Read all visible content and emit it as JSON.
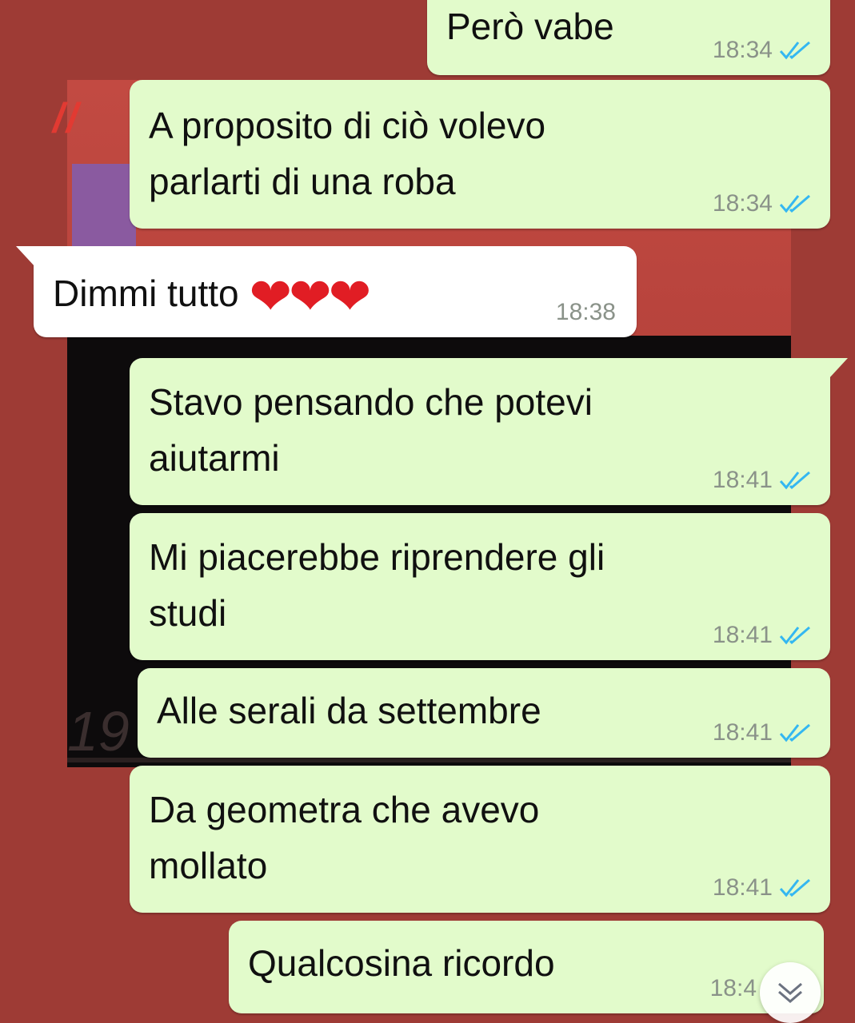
{
  "messages": [
    {
      "direction": "out",
      "lines": [
        "Però vabe"
      ],
      "time": "18:34",
      "status": "read-ticks-icon"
    },
    {
      "direction": "out",
      "lines": [
        "A proposito di ciò volevo",
        "parlarti di una roba"
      ],
      "time": "18:34",
      "status": "read-ticks-icon"
    },
    {
      "direction": "in",
      "lines": [
        "Dimmi tutto"
      ],
      "emoji": "❤❤❤",
      "time": "18:38"
    },
    {
      "direction": "out",
      "lines": [
        "Stavo pensando che potevi",
        "aiutarmi"
      ],
      "time": "18:41",
      "status": "read-ticks-icon"
    },
    {
      "direction": "out",
      "lines": [
        "Mi piacerebbe riprendere gli",
        "studi"
      ],
      "time": "18:41",
      "status": "read-ticks-icon"
    },
    {
      "direction": "out",
      "lines": [
        "Alle serali da settembre"
      ],
      "time": "18:41",
      "status": "read-ticks-icon"
    },
    {
      "direction": "out",
      "lines": [
        "Da geometra che avevo",
        "mollato"
      ],
      "time": "18:41",
      "status": "read-ticks-icon"
    },
    {
      "direction": "out",
      "lines": [
        "Qualcosina ricordo"
      ],
      "time": "18:4",
      "status": "read-ticks-icon"
    }
  ],
  "wallpaper": {
    "stripes": "/ /",
    "digit": "19"
  },
  "scroll_button": {
    "icon": "double-chevron-down-icon"
  },
  "colors": {
    "background": "#9e3b35",
    "outgoing_bubble": "#e2fbcb",
    "incoming_bubble": "#ffffff",
    "timestamp": "#8a9289",
    "read_ticks": "#34b7f1",
    "heart": "#e11d24"
  }
}
